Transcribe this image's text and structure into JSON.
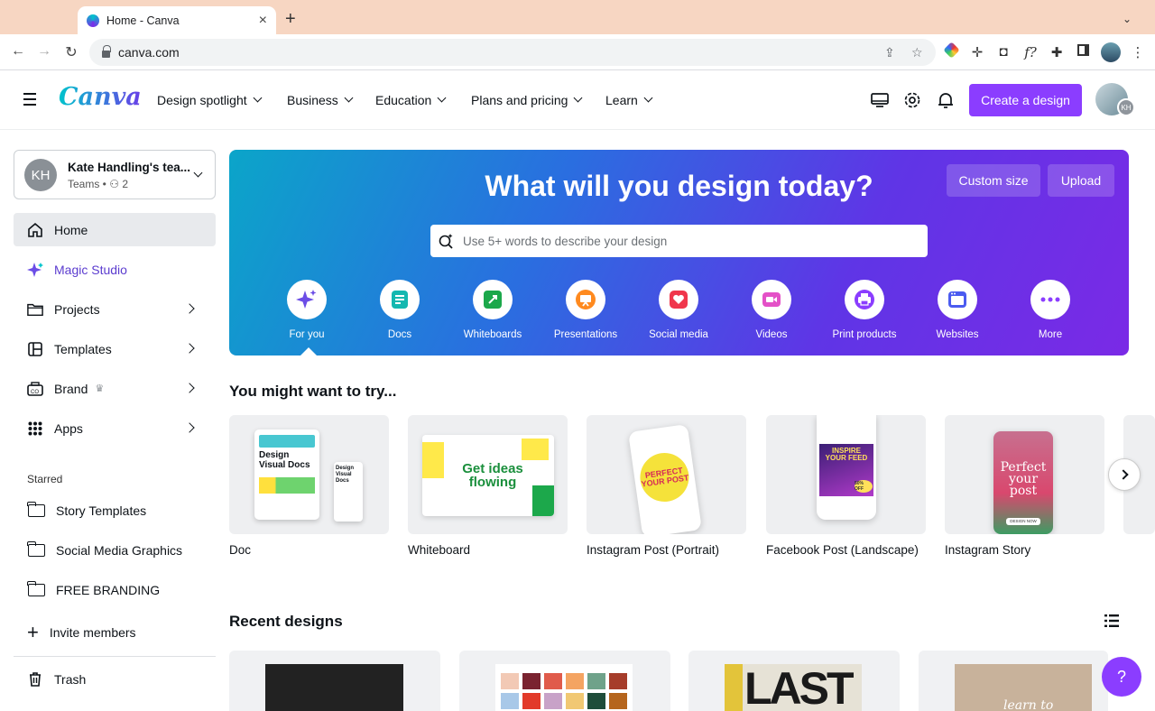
{
  "browser": {
    "tab_title": "Home - Canva",
    "url": "canva.com"
  },
  "header": {
    "logo": "Canva",
    "nav": [
      "Design spotlight",
      "Business",
      "Education",
      "Plans and pricing",
      "Learn"
    ],
    "create_label": "Create a design",
    "avatar_initials": "KH",
    "icons": [
      "desktop-icon",
      "gear-icon",
      "bell-icon"
    ]
  },
  "sidebar": {
    "team": {
      "name": "Kate Handling's tea...",
      "sub": "Teams •",
      "members": "2",
      "initials": "KH"
    },
    "items": [
      {
        "label": "Home",
        "icon": "home-icon"
      },
      {
        "label": "Magic Studio",
        "icon": "sparkle-icon"
      },
      {
        "label": "Projects",
        "icon": "folder-icon"
      },
      {
        "label": "Templates",
        "icon": "templates-icon"
      },
      {
        "label": "Brand",
        "icon": "brand-icon"
      },
      {
        "label": "Apps",
        "icon": "apps-icon"
      }
    ],
    "starred_heading": "Starred",
    "starred": [
      "Story Templates",
      "Social Media Graphics",
      "FREE BRANDING"
    ],
    "invite": "Invite members",
    "trash": "Trash"
  },
  "hero": {
    "title": "What will you design today?",
    "custom_size": "Custom size",
    "upload": "Upload",
    "search_placeholder": "Use 5+ words to describe your design",
    "categories": [
      "For you",
      "Docs",
      "Whiteboards",
      "Presentations",
      "Social media",
      "Videos",
      "Print products",
      "Websites",
      "More"
    ]
  },
  "suggest": {
    "heading": "You might want to try...",
    "cards": [
      "Doc",
      "Whiteboard",
      "Instagram Post (Portrait)",
      "Facebook Post (Landscape)",
      "Instagram Story"
    ],
    "thumb_text": {
      "doc": "Design Visual Docs",
      "whiteboard": "Get ideas flowing",
      "post": "PERFECT YOUR POST",
      "facebook": "INSPIRE YOUR FEED",
      "facebook_badge": "50% OFF",
      "story": "Perfect your post",
      "story_btn": "DESIGN NOW"
    }
  },
  "recent": {
    "heading": "Recent designs",
    "thumb_text": {
      "last": "LAST",
      "learn": "learn to"
    }
  },
  "help_label": "?",
  "colors": {
    "accent": "#8b3dff",
    "magic": "#5b3ccf"
  }
}
